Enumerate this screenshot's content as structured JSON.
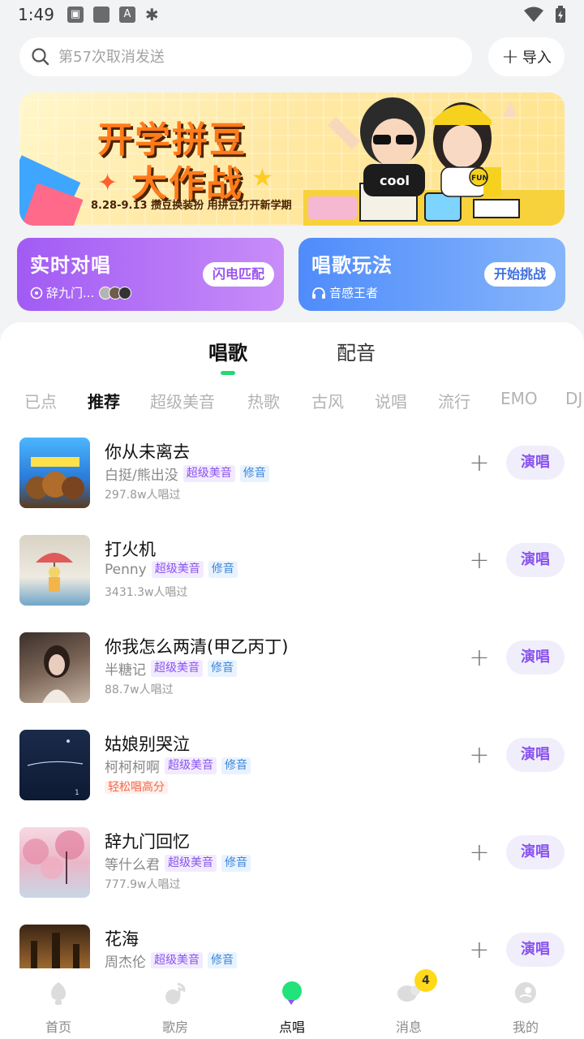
{
  "status_bar": {
    "time": "1:49"
  },
  "search": {
    "placeholder": "第57次取消发送",
    "import_label": "导入"
  },
  "banner": {
    "title_line1": "开学拼豆",
    "title_line2": "大作战",
    "subtitle": "8.28-9.13 攒豆换装扮 用拼豆打开新学期",
    "shirt_text": "cool",
    "badge_text": "FUN"
  },
  "cards": {
    "duet": {
      "title": "实时对唱",
      "subtitle": "辞九门...",
      "button": "闪电匹配"
    },
    "play": {
      "title": "唱歌玩法",
      "subtitle": "音感王者",
      "button": "开始挑战"
    }
  },
  "main_tabs": [
    {
      "label": "唱歌",
      "active": true
    },
    {
      "label": "配音",
      "active": false
    }
  ],
  "categories": [
    "已点",
    "推荐",
    "超级美音",
    "热歌",
    "古风",
    "说唱",
    "流行",
    "EMO",
    "DJ"
  ],
  "songs": [
    {
      "title": "你从未离去",
      "artist": "白挺/熊出没",
      "tags": [
        "超级美音",
        "修音"
      ],
      "count": "297.8w人唱过",
      "extra": ""
    },
    {
      "title": "打火机",
      "artist": "Penny",
      "tags": [
        "超级美音",
        "修音"
      ],
      "count": "3431.3w人唱过",
      "extra": ""
    },
    {
      "title": "你我怎么两清(甲乙丙丁)",
      "artist": "半糖记",
      "tags": [
        "超级美音",
        "修音"
      ],
      "count": "88.7w人唱过",
      "extra": ""
    },
    {
      "title": "姑娘别哭泣",
      "artist": "柯柯柯啊",
      "tags": [
        "超级美音",
        "修音"
      ],
      "count": "",
      "extra": "轻松唱高分"
    },
    {
      "title": "辞九门回忆",
      "artist": "等什么君",
      "tags": [
        "超级美音",
        "修音"
      ],
      "count": "777.9w人唱过",
      "extra": ""
    },
    {
      "title": "花海",
      "artist": "周杰伦",
      "tags": [
        "超级美音",
        "修音"
      ],
      "count": "",
      "extra": ""
    }
  ],
  "sing_label": "演唱",
  "bottom_nav": [
    {
      "label": "首页",
      "active": false
    },
    {
      "label": "歌房",
      "active": false
    },
    {
      "label": "点唱",
      "active": true
    },
    {
      "label": "消息",
      "active": false,
      "badge": "4"
    },
    {
      "label": "我的",
      "active": false
    }
  ],
  "colors": {
    "accent_green": "#22d974",
    "accent_purple": "#8a54ef",
    "card_duet": "#a15bf4",
    "card_play": "#4f8cfb"
  }
}
